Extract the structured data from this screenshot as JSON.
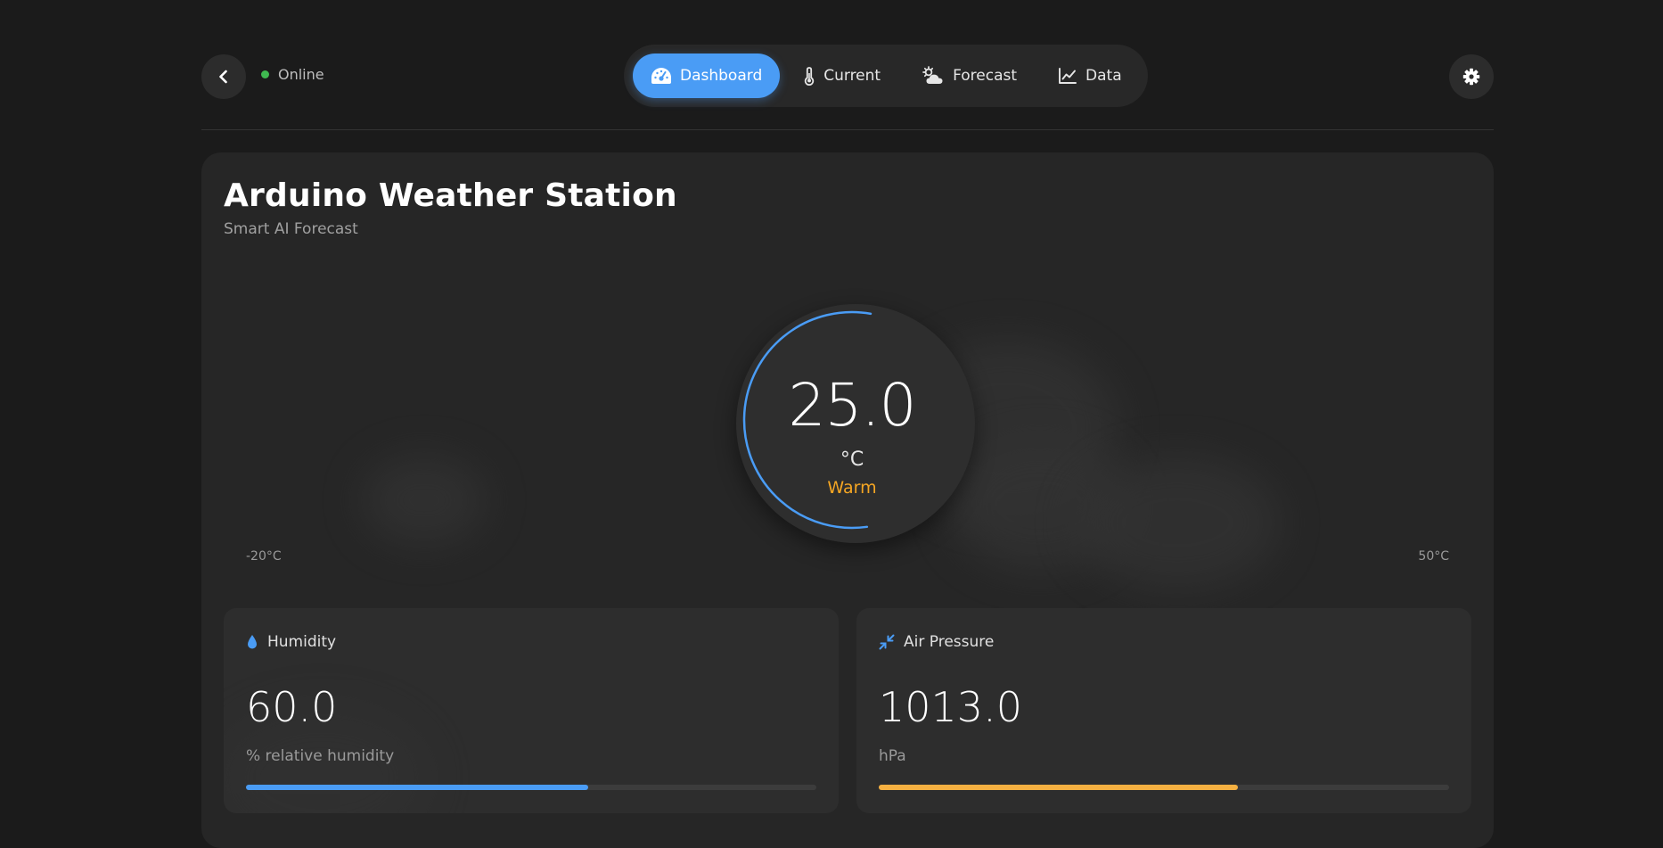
{
  "header": {
    "status": "Online",
    "tabs": [
      {
        "label": "Dashboard",
        "icon": "gauge-icon",
        "active": true
      },
      {
        "label": "Current",
        "icon": "thermometer-icon",
        "active": false
      },
      {
        "label": "Forecast",
        "icon": "sun-cloud-icon",
        "active": false
      },
      {
        "label": "Data",
        "icon": "line-chart-icon",
        "active": false
      }
    ]
  },
  "main": {
    "title": "Arduino Weather Station",
    "subtitle": "Smart AI Forecast",
    "temperature": {
      "value": "25.0",
      "unit": "°C",
      "label": "Warm",
      "label_color": "#f5a623",
      "arc_color": "#4a9cf5",
      "scale_min": "-20°C",
      "scale_max": "50°C",
      "arc_fraction": 0.55
    },
    "humidity": {
      "title": "Humidity",
      "icon": "droplet-icon",
      "value": "60.0",
      "unit": "% relative humidity",
      "bar_fraction": 0.6,
      "bar_color": "#4a9cf5"
    },
    "pressure": {
      "title": "Air Pressure",
      "icon": "compress-arrows-icon",
      "value": "1013.0",
      "unit": "hPa",
      "bar_fraction": 0.63,
      "bar_color": "#f5b041"
    }
  }
}
